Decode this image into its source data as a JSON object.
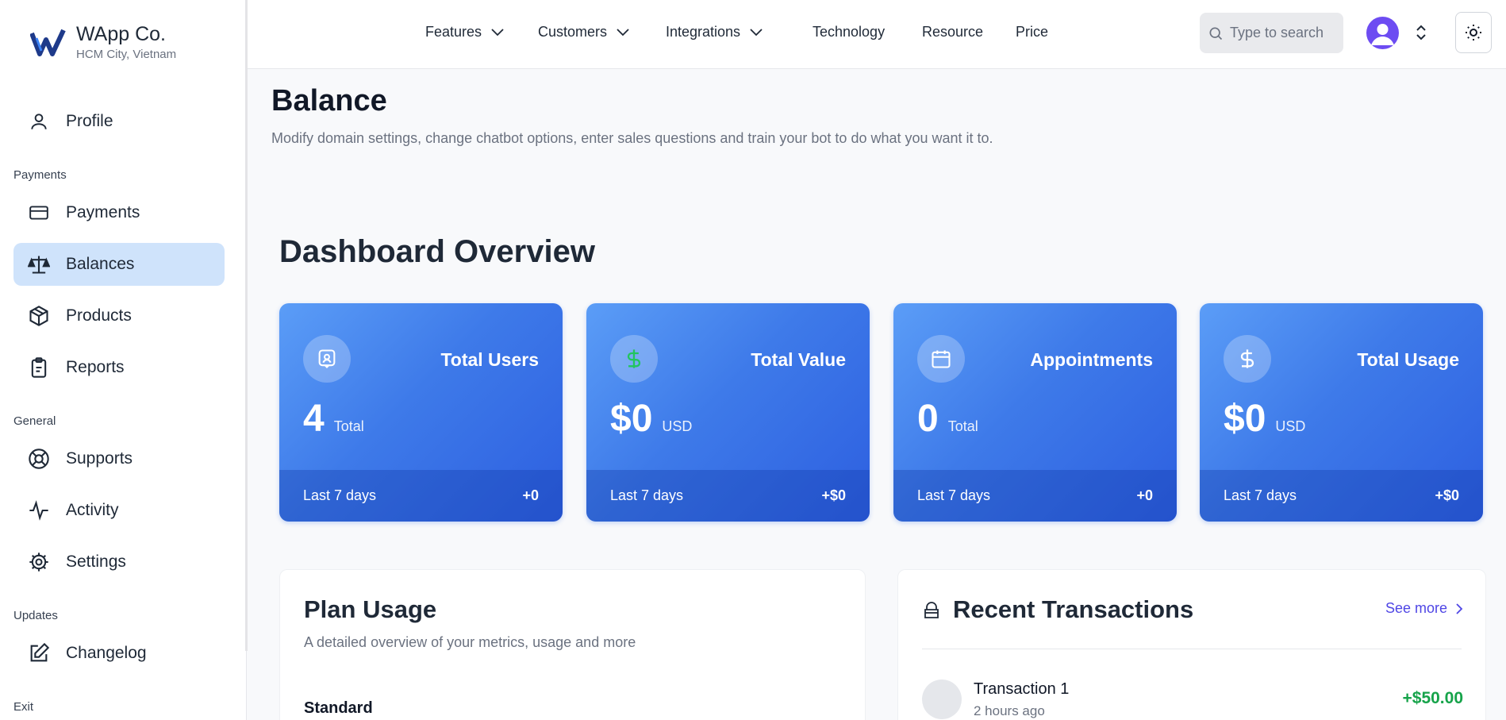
{
  "brand": {
    "name": "WApp Co.",
    "location": "HCM City, Vietnam",
    "logo_icon": "w-logo-icon"
  },
  "sidebar": {
    "sections": {
      "payments": "Payments",
      "general": "General",
      "updates": "Updates",
      "exit": "Exit"
    },
    "items": [
      {
        "label": "Profile",
        "icon": "user-icon"
      },
      {
        "label": "Payments",
        "icon": "credit-card-icon"
      },
      {
        "label": "Balances",
        "icon": "scale-icon",
        "active": true
      },
      {
        "label": "Products",
        "icon": "box-icon"
      },
      {
        "label": "Reports",
        "icon": "clipboard-icon"
      },
      {
        "label": "Supports",
        "icon": "lifebuoy-icon"
      },
      {
        "label": "Activity",
        "icon": "activity-icon"
      },
      {
        "label": "Settings",
        "icon": "gear-icon"
      },
      {
        "label": "Changelog",
        "icon": "edit-icon"
      }
    ]
  },
  "topbar": {
    "nav": [
      "Features",
      "Customers",
      "Integrations",
      "Technology",
      "Resource",
      "Price"
    ],
    "search": {
      "placeholder": "Type to search"
    },
    "icons": {
      "avatar": "avatar",
      "selector": "chevron-up-down-icon",
      "theme": "sun-icon"
    }
  },
  "page": {
    "title": "Balance",
    "subtitle": "Modify domain settings, change chatbot options, enter sales questions and train your bot to do what you want it to."
  },
  "dashboard": {
    "title": "Dashboard Overview",
    "cards": [
      {
        "title": "Total Users",
        "value": "4",
        "unit": "Total",
        "period": "Last 7 days",
        "delta": "+0",
        "icon": "user-badge-icon"
      },
      {
        "title": "Total Value",
        "value": "$0",
        "unit": "USD",
        "period": "Last 7 days",
        "delta": "+$0",
        "icon": "dollar-icon"
      },
      {
        "title": "Appointments",
        "value": "0",
        "unit": "Total",
        "period": "Last 7 days",
        "delta": "+0",
        "icon": "calendar-icon"
      },
      {
        "title": "Total Usage",
        "value": "$0",
        "unit": "USD",
        "period": "Last 7 days",
        "delta": "+$0",
        "icon": "dollar-icon"
      }
    ]
  },
  "plan_usage": {
    "title": "Plan Usage",
    "subtitle": "A detailed overview of your metrics, usage and more",
    "plan": "Standard"
  },
  "transactions": {
    "title": "Recent Transactions",
    "see_more": "See more",
    "items": [
      {
        "name": "Transaction 1",
        "time": "2 hours ago",
        "amount": "+$50.00"
      }
    ]
  },
  "colors": {
    "accent": "#3e7ae9",
    "active_nav": "#cfe3fb",
    "positive": "#16a34a",
    "link": "#4f46e5"
  }
}
